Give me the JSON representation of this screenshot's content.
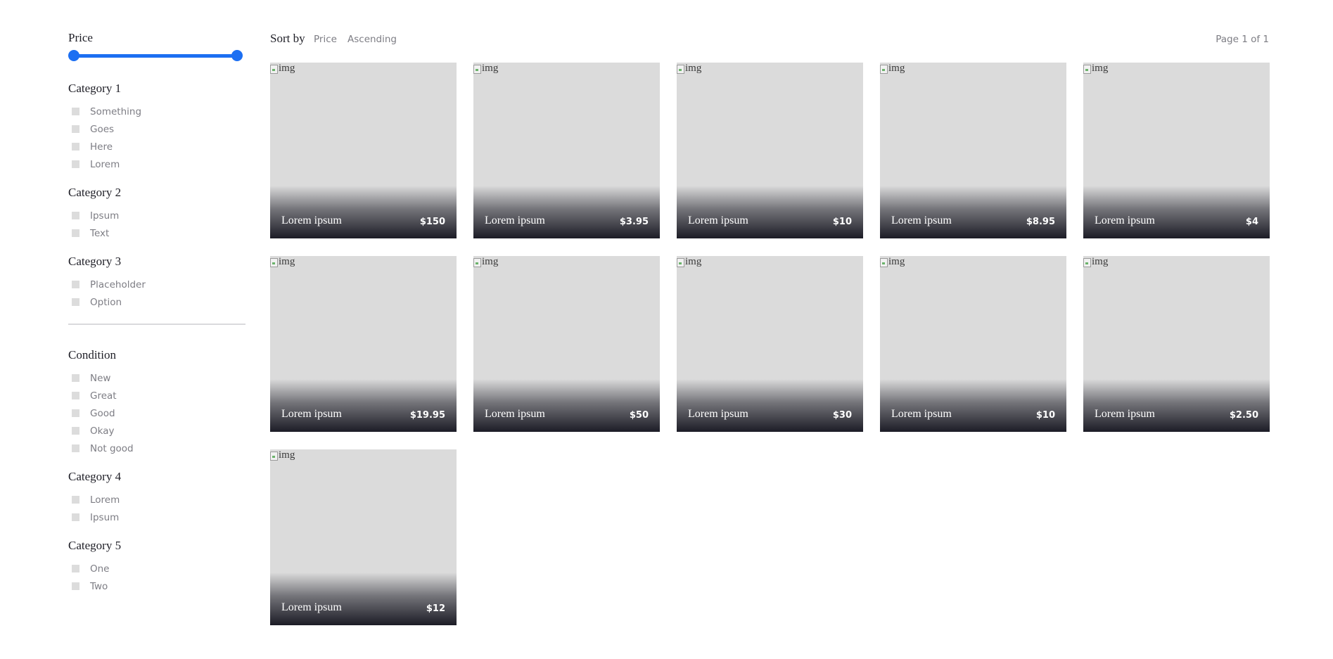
{
  "filters": {
    "price_title": "Price",
    "price_range_fraction": [
      0,
      1
    ],
    "groups": [
      {
        "title": "Category 1",
        "options": [
          "Something",
          "Goes",
          "Here",
          "Lorem"
        ]
      },
      {
        "title": "Category 2",
        "options": [
          "Ipsum",
          "Text"
        ]
      },
      {
        "title": "Category 3",
        "options": [
          "Placeholder",
          "Option"
        ]
      }
    ],
    "groups_after_divider": [
      {
        "title": "Condition",
        "options": [
          "New",
          "Great",
          "Good",
          "Okay",
          "Not good"
        ]
      },
      {
        "title": "Category 4",
        "options": [
          "Lorem",
          "Ipsum"
        ]
      },
      {
        "title": "Category 5",
        "options": [
          "One",
          "Two"
        ]
      }
    ]
  },
  "toolbar": {
    "sort_label": "Sort by",
    "sort_field": "Price",
    "sort_order": "Ascending",
    "page_info": "Page 1 of 1"
  },
  "products": [
    {
      "alt": "img",
      "name": "Lorem ipsum",
      "price": "$150"
    },
    {
      "alt": "img",
      "name": "Lorem ipsum",
      "price": "$3.95"
    },
    {
      "alt": "img",
      "name": "Lorem ipsum",
      "price": "$10"
    },
    {
      "alt": "img",
      "name": "Lorem ipsum",
      "price": "$8.95"
    },
    {
      "alt": "img",
      "name": "Lorem ipsum",
      "price": "$4"
    },
    {
      "alt": "img",
      "name": "Lorem ipsum",
      "price": "$19.95"
    },
    {
      "alt": "img",
      "name": "Lorem ipsum",
      "price": "$50"
    },
    {
      "alt": "img",
      "name": "Lorem ipsum",
      "price": "$30"
    },
    {
      "alt": "img",
      "name": "Lorem ipsum",
      "price": "$10"
    },
    {
      "alt": "img",
      "name": "Lorem ipsum",
      "price": "$2.50"
    },
    {
      "alt": "img",
      "name": "Lorem ipsum",
      "price": "$12"
    }
  ],
  "colors": {
    "accent": "#1c6ff2",
    "placeholder": "#dbdbdb",
    "overlay_dark": "#1c1c26",
    "muted_text": "#7d7d84"
  }
}
